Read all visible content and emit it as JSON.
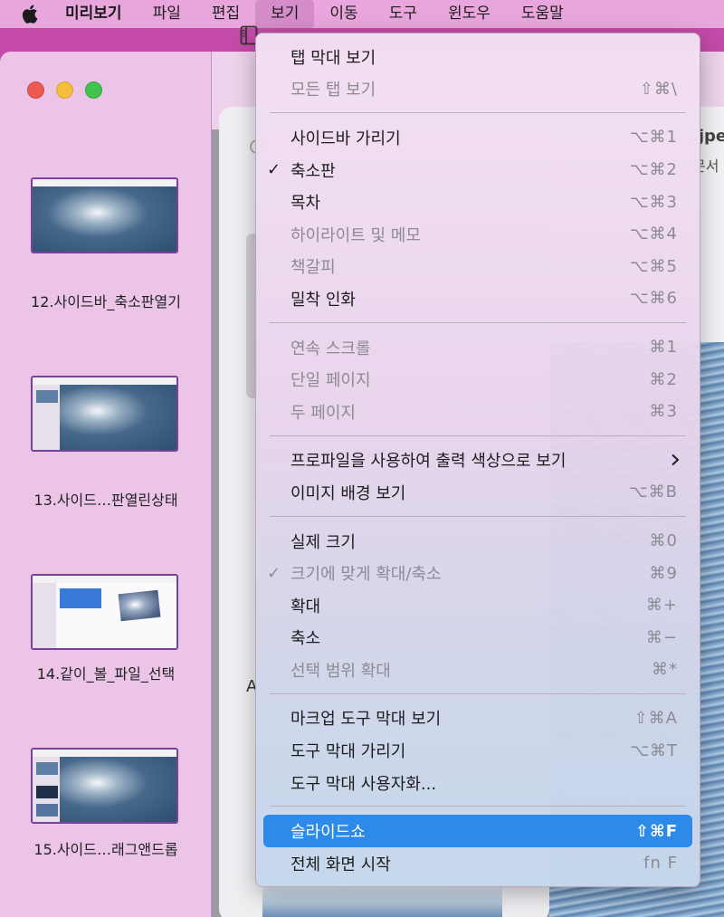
{
  "menubar": {
    "app_name": "미리보기",
    "items": [
      "파일",
      "편집",
      "보기",
      "이동",
      "도구",
      "윈도우",
      "도움말"
    ],
    "active": "보기"
  },
  "sidebar": {
    "thumbnails": [
      {
        "label": "12.사이드바_축소판열기"
      },
      {
        "label": "13.사이드…판열린상태"
      },
      {
        "label": "14.같이_볼_파일_선택"
      },
      {
        "label": "15.사이드…래그앤드롭"
      }
    ]
  },
  "document": {
    "title_fragment": ".jpe",
    "subtitle_fragment": "문서",
    "page_letter": "A"
  },
  "view_menu": {
    "group1": [
      {
        "label": "탭 막대 보기",
        "shortcut": "",
        "disabled": false
      },
      {
        "label": "모든 탭 보기",
        "shortcut": "⇧⌘\\",
        "disabled": true
      }
    ],
    "group2": [
      {
        "label": "사이드바 가리기",
        "shortcut": "⌥⌘1",
        "disabled": false
      },
      {
        "label": "축소판",
        "shortcut": "⌥⌘2",
        "disabled": false,
        "checked": true
      },
      {
        "label": "목차",
        "shortcut": "⌥⌘3",
        "disabled": false
      },
      {
        "label": "하이라이트 및 메모",
        "shortcut": "⌥⌘4",
        "disabled": true
      },
      {
        "label": "책갈피",
        "shortcut": "⌥⌘5",
        "disabled": true
      },
      {
        "label": "밀착 인화",
        "shortcut": "⌥⌘6",
        "disabled": false
      }
    ],
    "group3": [
      {
        "label": "연속 스크롤",
        "shortcut": "⌘1",
        "disabled": true
      },
      {
        "label": "단일 페이지",
        "shortcut": "⌘2",
        "disabled": true
      },
      {
        "label": "두 페이지",
        "shortcut": "⌘3",
        "disabled": true
      }
    ],
    "group4": [
      {
        "label": "프로파일을 사용하여 출력 색상으로 보기",
        "shortcut": "",
        "disabled": false,
        "submenu": true
      },
      {
        "label": "이미지 배경 보기",
        "shortcut": "⌥⌘B",
        "disabled": false
      }
    ],
    "group5": [
      {
        "label": "실제 크기",
        "shortcut": "⌘0",
        "disabled": false
      },
      {
        "label": "크기에 맞게 확대/축소",
        "shortcut": "⌘9",
        "disabled": true,
        "checked": true
      },
      {
        "label": "확대",
        "shortcut": "⌘+",
        "disabled": false
      },
      {
        "label": "축소",
        "shortcut": "⌘−",
        "disabled": false
      },
      {
        "label": "선택 범위 확대",
        "shortcut": "⌘*",
        "disabled": true
      }
    ],
    "group6": [
      {
        "label": "마크업 도구 막대 보기",
        "shortcut": "⇧⌘A",
        "disabled": false
      },
      {
        "label": "도구 막대 가리기",
        "shortcut": "⌥⌘T",
        "disabled": false
      },
      {
        "label": "도구 막대 사용자화...",
        "shortcut": "",
        "disabled": false
      }
    ],
    "group7": [
      {
        "label": "슬라이드쇼",
        "shortcut": "⇧⌘F",
        "disabled": false,
        "highlighted": true
      },
      {
        "label": "전체 화면 시작",
        "shortcut": "fn F",
        "disabled": false
      }
    ]
  },
  "colors": {
    "menubar_bg": "#e9a6dc",
    "highlight": "#2d8ae9",
    "disabled_text": "#8d8a93"
  }
}
